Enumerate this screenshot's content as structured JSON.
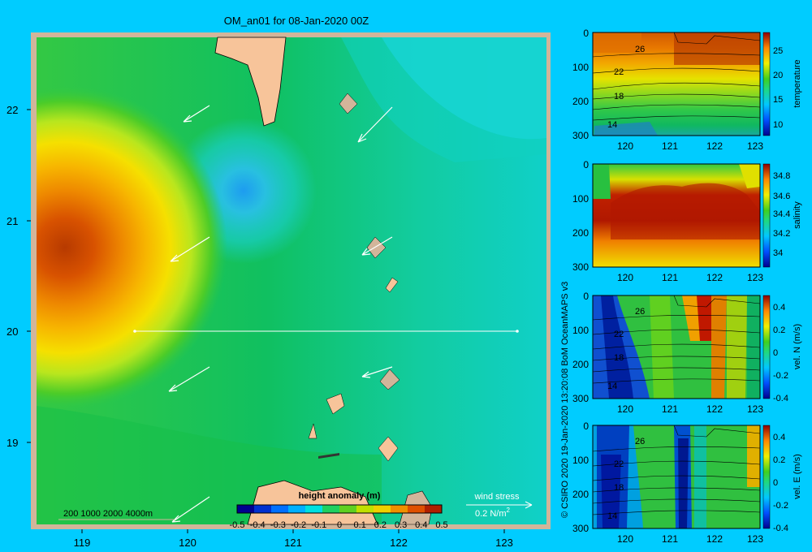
{
  "title": "OM_an01 for 08-Jan-2020 00Z",
  "map": {
    "lat_ticks": [
      "22",
      "21",
      "20",
      "19"
    ],
    "lon_ticks": [
      "119",
      "120",
      "121",
      "122",
      "123"
    ],
    "depth_legend": "200  1000  2000  4000m",
    "colorbar": {
      "label": "height anomaly  (m)",
      "ticks": [
        "-0.5",
        "-0.4",
        "-0.3",
        "-0.2",
        "-0.1",
        "0",
        "0.1",
        "0.2",
        "0.3",
        "0.4",
        "0.5"
      ],
      "range": [
        -0.5,
        0.5
      ]
    },
    "wind_stress": {
      "label": "wind stress",
      "scale": "0.2 N/m",
      "exp": "2"
    },
    "section_line_lat": 20.0
  },
  "panels": [
    {
      "key": "temperature",
      "label": "temperature",
      "cbar_ticks": [
        "25",
        "20",
        "15",
        "10"
      ],
      "contour_labels": [
        "26",
        "22",
        "18",
        "14"
      ]
    },
    {
      "key": "salinity",
      "label": "salinity",
      "cbar_ticks": [
        "34.8",
        "34.6",
        "34.4",
        "34.2",
        "34"
      ],
      "contour_labels": []
    },
    {
      "key": "veln",
      "label": "vel. N (m/s)",
      "cbar_ticks": [
        "0.4",
        "0.2",
        "0",
        "-0.2",
        "-0.4"
      ],
      "contour_labels": [
        "26",
        "22",
        "18",
        "14"
      ]
    },
    {
      "key": "vele",
      "label": "vel. E (m/s)",
      "cbar_ticks": [
        "0.4",
        "0.2",
        "0",
        "-0.2",
        "-0.4"
      ],
      "contour_labels": [
        "26",
        "22",
        "18",
        "14"
      ]
    }
  ],
  "panel_x_ticks": [
    "120",
    "121",
    "122",
    "123"
  ],
  "panel_y_ticks": [
    "0",
    "100",
    "200",
    "300"
  ],
  "credit": "© CSIRO 2020   19-Jan-2020 13:20:08 BoM OceanMAPS v3"
}
